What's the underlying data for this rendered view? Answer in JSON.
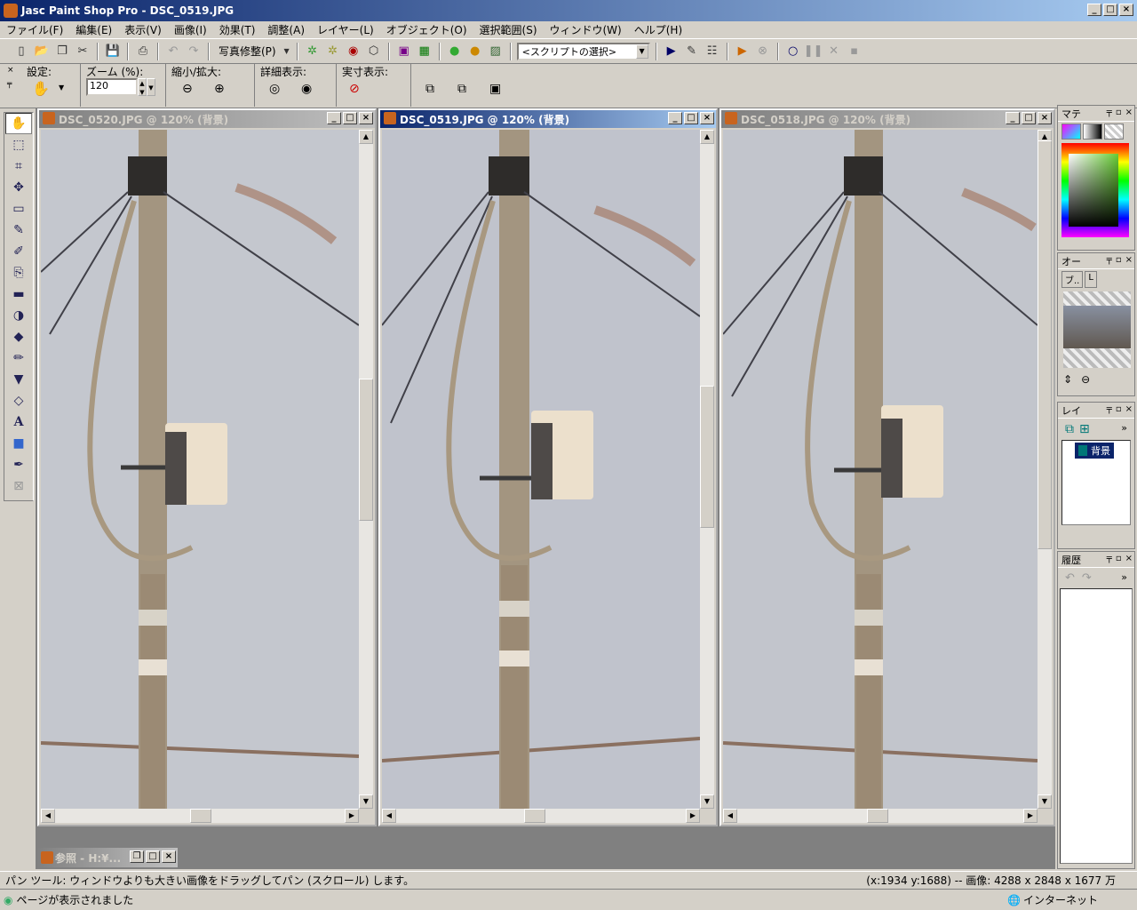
{
  "app": {
    "title": "Jasc Paint Shop Pro - DSC_0519.JPG"
  },
  "menu": [
    "ファイル(F)",
    "編集(E)",
    "表示(V)",
    "画像(I)",
    "効果(T)",
    "調整(A)",
    "レイヤー(L)",
    "オブジェクト(O)",
    "選択範囲(S)",
    "ウィンドウ(W)",
    "ヘルプ(H)"
  ],
  "toolbar": {
    "photo_fix": "写真修整(P)",
    "script_select": "<スクリプトの選択>"
  },
  "tool_options": {
    "settings_label": "設定:",
    "zoom_label": "ズーム (%):",
    "zoom_value": "120",
    "zoomio_label": "縮小/拡大:",
    "detail_label": "詳細表示:",
    "actual_label": "実寸表示:"
  },
  "documents": [
    {
      "title": "DSC_0520.JPG @ 120% (背景)",
      "active": false
    },
    {
      "title": "DSC_0519.JPG @ 120% (背景)",
      "active": true
    },
    {
      "title": "DSC_0518.JPG @ 120% (背景)",
      "active": false
    }
  ],
  "ref_window": {
    "title": "参照 - H:¥..."
  },
  "panels": {
    "materials": "マテ",
    "overview": "オー",
    "overview_tabs": [
      "ブ..",
      "L"
    ],
    "layers": "レイ",
    "layer_name": "背景",
    "history": "履歴"
  },
  "status": {
    "message": "パン ツール: ウィンドウよりも大きい画像をドラッグしてパン (スクロール) します。",
    "info": "(x:1934 y:1688) -- 画像: 4288 x 2848 x 1677 万"
  },
  "ie": {
    "left": "ページが表示されました",
    "zone": "インターネット"
  }
}
